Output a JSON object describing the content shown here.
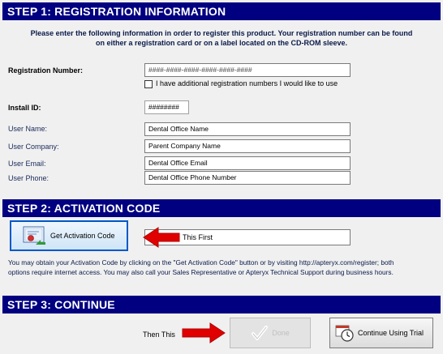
{
  "step1": {
    "header": "STEP 1: REGISTRATION INFORMATION",
    "intro_line1": "Please enter the following information in order to register this product.  Your registration number can be found",
    "intro_line2": "on either a registration card or on a label located on the CD-ROM sleeve.",
    "registration_number_label": "Registration Number:",
    "registration_number_value": "####-####-####-####-####-####",
    "additional_checkbox_label": "I have additional registration numbers I would like to use",
    "additional_checked": false,
    "install_id_label": "Install ID:",
    "install_id_value": "########",
    "user_name_label": "User Name:",
    "user_name_value": "Dental Office Name",
    "user_company_label": "User Company:",
    "user_company_value": "Parent Company Name",
    "user_email_label": "User Email:",
    "user_email_value": "Dental Office Email",
    "user_phone_label": "User Phone:",
    "user_phone_value": "Dental Office Phone Number"
  },
  "step2": {
    "header": "STEP 2: ACTIVATION CODE",
    "get_code_button": "Get Activation Code",
    "annotation_this_first": "This First",
    "activation_code_value": "",
    "note_line1": "You may obtain your Activation Code by clicking on the \"Get Activation Code\" button or by visiting http://apteryx.com/register; both",
    "note_line2": "options require internet access. You may also call your Sales Representative or Apteryx Technical Support during business hours."
  },
  "step3": {
    "header": "STEP 3: CONTINUE",
    "annotation_then_this": "Then This",
    "done_button": "Done",
    "trial_button": "Continue Using Trial"
  },
  "icons": {
    "certificate": "certificate-icon",
    "checkmark": "checkmark-icon",
    "clock": "clock-icon",
    "arrow": "red-arrow-icon"
  },
  "colors": {
    "header_bg": "#000080",
    "annotation_arrow": "#e00000",
    "focus_border": "#0058c8"
  }
}
